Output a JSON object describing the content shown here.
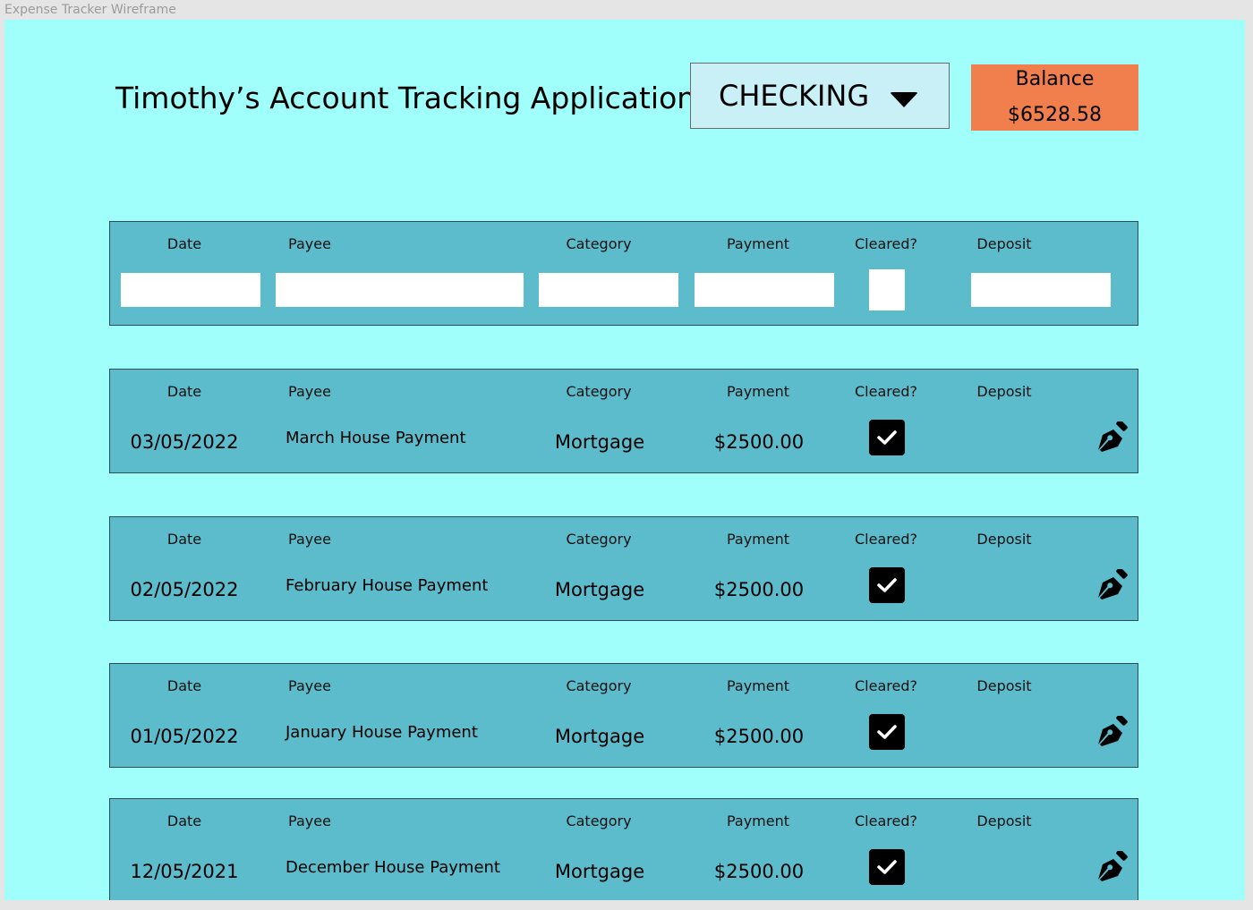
{
  "window": {
    "frame_title": "Expense Tracker Wireframe"
  },
  "header": {
    "title": "Timothy’s Account Tracking Application",
    "account_select": {
      "selected": "CHECKING",
      "icon": "caret-down-icon"
    },
    "balance": {
      "label": "Balance",
      "amount": "$6528.58"
    }
  },
  "columns": {
    "date": "Date",
    "payee": "Payee",
    "category": "Category",
    "payment": "Payment",
    "cleared": "Cleared?",
    "deposit": "Deposit"
  },
  "entry_form": {
    "date": "",
    "payee": "",
    "category": "",
    "payment": "",
    "cleared": false,
    "deposit": ""
  },
  "transactions": [
    {
      "date": "03/05/2022",
      "payee": "March House Payment",
      "category": "Mortgage",
      "payment": "$2500.00",
      "cleared": true,
      "deposit": ""
    },
    {
      "date": "02/05/2022",
      "payee": "February House Payment",
      "category": "Mortgage",
      "payment": "$2500.00",
      "cleared": true,
      "deposit": ""
    },
    {
      "date": "01/05/2022",
      "payee": "January House Payment",
      "category": "Mortgage",
      "payment": "$2500.00",
      "cleared": true,
      "deposit": ""
    },
    {
      "date": "12/05/2021",
      "payee": "December House Payment",
      "category": "Mortgage",
      "payment": "$2500.00",
      "cleared": true,
      "deposit": ""
    }
  ],
  "icons": {
    "checkmark": "checkmark-icon",
    "edit": "pen-nib-edit-icon",
    "dropdown": "caret-down-icon"
  },
  "colors": {
    "canvas_background": "#a0fffa",
    "panel": "#5cbccb",
    "select_background": "#c9f0f7",
    "balance_background": "#f07f4d",
    "checkbox": "#000000"
  }
}
